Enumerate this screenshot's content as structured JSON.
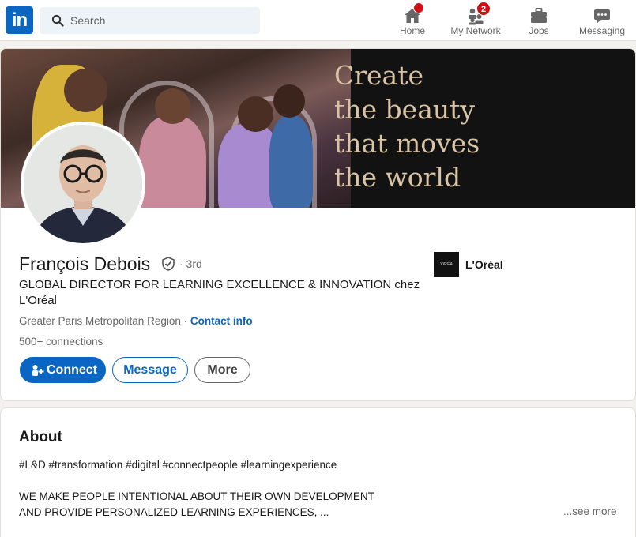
{
  "nav": {
    "logo_text": "in",
    "search_placeholder": "Search",
    "items": [
      {
        "label": "Home",
        "icon": "home-icon",
        "badge": ""
      },
      {
        "label": "My Network",
        "icon": "network-icon",
        "badge": "2"
      },
      {
        "label": "Jobs",
        "icon": "briefcase-icon",
        "badge": ""
      },
      {
        "label": "Messaging",
        "icon": "messaging-icon",
        "badge": ""
      }
    ],
    "accent": "#0a66c2",
    "badge_color": "#cc1016"
  },
  "banner": {
    "tagline": [
      "Create",
      "the beauty",
      "that moves",
      "the world"
    ]
  },
  "profile": {
    "name": "François Debois",
    "degree": "· 3rd",
    "headline": "GLOBAL DIRECTOR FOR LEARNING EXCELLENCE & INNOVATION chez L'Oréal",
    "location": "Greater Paris Metropolitan Region · ",
    "contact_info": "Contact info",
    "connections": "500+ connections",
    "company": "L'Oréal",
    "company_logo_text": "L'ORÉAL"
  },
  "actions": {
    "connect": "Connect",
    "message": "Message",
    "more": "More"
  },
  "about": {
    "title": "About",
    "hashtags": "#L&D #transformation #digital #connectpeople #learningexperience",
    "line1": "WE MAKE PEOPLE INTENTIONAL ABOUT THEIR OWN DEVELOPMENT",
    "line2": "AND PROVIDE PERSONALIZED LEARNING EXPERIENCES, ...",
    "see_more": "...see more"
  }
}
